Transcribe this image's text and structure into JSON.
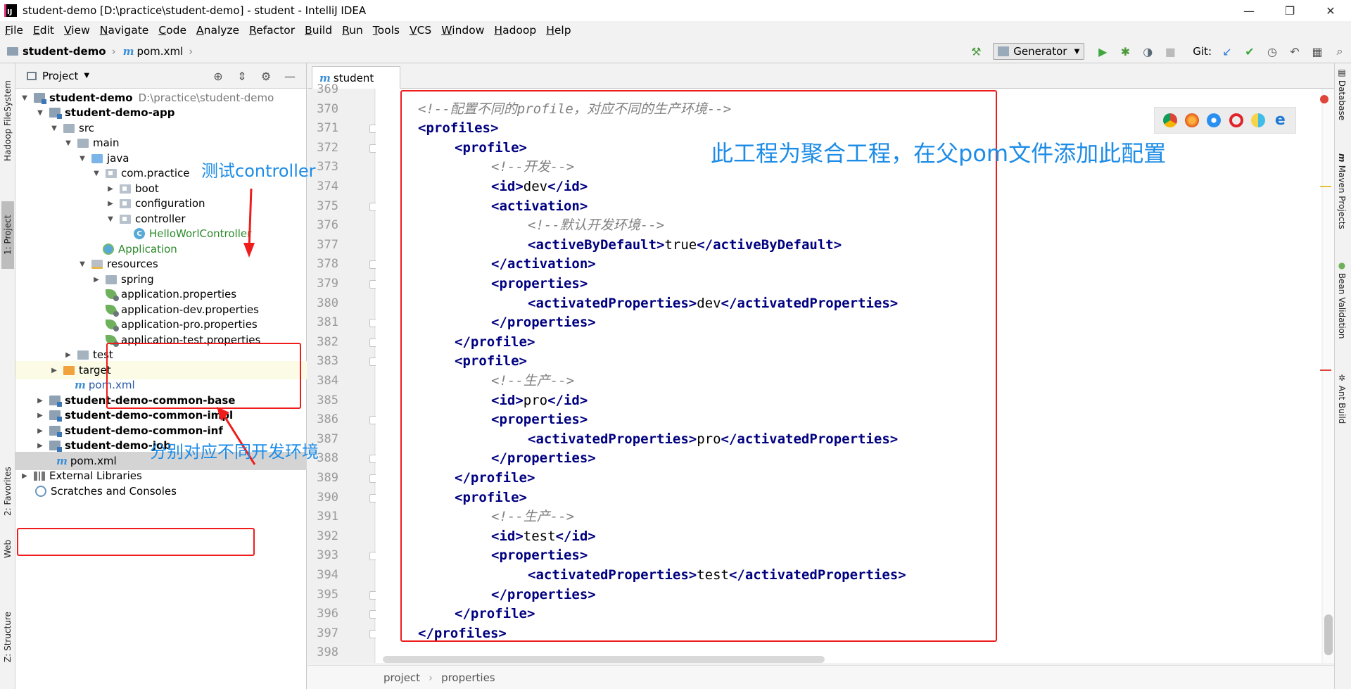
{
  "window": {
    "title": "student-demo [D:\\practice\\student-demo] - student - IntelliJ IDEA",
    "logo_text": "IJ",
    "minimize_glyph": "—",
    "maximize_glyph": "❐",
    "close_glyph": "✕"
  },
  "menu": [
    "File",
    "Edit",
    "View",
    "Navigate",
    "Code",
    "Analyze",
    "Refactor",
    "Build",
    "Run",
    "Tools",
    "VCS",
    "Window",
    "Hadoop",
    "Help"
  ],
  "breadcrumb": {
    "project": "student-demo",
    "file": "pom.xml",
    "file_icon": "m"
  },
  "toolbar": {
    "run_config": "Generator",
    "git_label": "Git:",
    "icons": [
      "hammer-icon",
      "run-icon",
      "debug-icon",
      "coverage-icon",
      "stop-icon",
      "vcs-update-icon",
      "vcs-commit-icon",
      "history-icon",
      "revert-icon",
      "project-structure-icon",
      "search-icon"
    ]
  },
  "left_tabs": {
    "hadoop": "Hadoop FileSystem",
    "project": "1: Project",
    "favorites": "2: Favorites",
    "web": "Web",
    "structure": "Z: Structure"
  },
  "right_tabs": {
    "database": "Database",
    "maven": "Maven Projects",
    "bean": "Bean Validation",
    "ant": "Ant Build"
  },
  "project_panel": {
    "title": "Project",
    "tree": [
      {
        "label": "student-demo",
        "hint": "D:\\practice\\student-demo"
      },
      {
        "label": "student-demo-app"
      },
      {
        "label": "src"
      },
      {
        "label": "main"
      },
      {
        "label": "java"
      },
      {
        "label": "com.practice"
      },
      {
        "label": "boot"
      },
      {
        "label": "configuration"
      },
      {
        "label": "controller"
      },
      {
        "label": "HelloWorlController"
      },
      {
        "label": "Application"
      },
      {
        "label": "resources"
      },
      {
        "label": "spring"
      },
      {
        "label": "application.properties"
      },
      {
        "label": "application-dev.properties"
      },
      {
        "label": "application-pro.properties"
      },
      {
        "label": "application-test.properties"
      },
      {
        "label": "test"
      },
      {
        "label": "target"
      },
      {
        "label": "pom.xml"
      },
      {
        "label": "student-demo-common-base"
      },
      {
        "label": "student-demo-common-impl"
      },
      {
        "label": "student-demo-common-inf"
      },
      {
        "label": "student-demo-job"
      },
      {
        "label": "pom.xml"
      },
      {
        "label": "External Libraries"
      },
      {
        "label": "Scratches and Consoles"
      }
    ]
  },
  "editor": {
    "tab": "student",
    "line_numbers": [
      "369",
      "370",
      "371",
      "372",
      "373",
      "374",
      "375",
      "376",
      "377",
      "378",
      "379",
      "380",
      "381",
      "382",
      "383",
      "384",
      "385",
      "386",
      "387",
      "388",
      "389",
      "390",
      "391",
      "392",
      "393",
      "394",
      "395",
      "396",
      "397",
      "398"
    ],
    "lines": [
      [],
      [
        [
          "cmt",
          "<!--配置不同的profile，对应不同的生产环境-->"
        ]
      ],
      [
        [
          "tag",
          "<profiles>"
        ]
      ],
      [
        [
          "tag",
          "<profile>"
        ]
      ],
      [
        [
          "cmt",
          "<!--开发-->"
        ]
      ],
      [
        [
          "tag",
          "<id>"
        ],
        [
          "txt",
          "dev"
        ],
        [
          "tag",
          "</id>"
        ]
      ],
      [
        [
          "tag",
          "<activation>"
        ]
      ],
      [
        [
          "cmt",
          "<!--默认开发环境-->"
        ]
      ],
      [
        [
          "tag",
          "<activeByDefault>"
        ],
        [
          "txt",
          "true"
        ],
        [
          "tag",
          "</activeByDefault>"
        ]
      ],
      [
        [
          "tag",
          "</activation>"
        ]
      ],
      [
        [
          "tag",
          "<properties>"
        ]
      ],
      [
        [
          "tag",
          "<activatedProperties>"
        ],
        [
          "txt",
          "dev"
        ],
        [
          "tag",
          "</activatedProperties>"
        ]
      ],
      [
        [
          "tag",
          "</properties>"
        ]
      ],
      [
        [
          "tag",
          "</profile>"
        ]
      ],
      [
        [
          "tag",
          "<profile>"
        ]
      ],
      [
        [
          "cmt",
          "<!--生产-->"
        ]
      ],
      [
        [
          "tag",
          "<id>"
        ],
        [
          "txt",
          "pro"
        ],
        [
          "tag",
          "</id>"
        ]
      ],
      [
        [
          "tag",
          "<properties>"
        ]
      ],
      [
        [
          "tag",
          "<activatedProperties>"
        ],
        [
          "txt",
          "pro"
        ],
        [
          "tag",
          "</activatedProperties>"
        ]
      ],
      [
        [
          "tag",
          "</properties>"
        ]
      ],
      [
        [
          "tag",
          "</profile>"
        ]
      ],
      [
        [
          "tag",
          "<profile>"
        ]
      ],
      [
        [
          "cmt",
          "<!--生产-->"
        ]
      ],
      [
        [
          "tag",
          "<id>"
        ],
        [
          "txt",
          "test"
        ],
        [
          "tag",
          "</id>"
        ]
      ],
      [
        [
          "tag",
          "<properties>"
        ]
      ],
      [
        [
          "tag",
          "<activatedProperties>"
        ],
        [
          "txt",
          "test"
        ],
        [
          "tag",
          "</activatedProperties>"
        ]
      ],
      [
        [
          "tag",
          "</properties>"
        ]
      ],
      [
        [
          "tag",
          "</profile>"
        ]
      ],
      [
        [
          "tag",
          "</profiles>"
        ]
      ],
      []
    ]
  },
  "annotations": {
    "controller_note": "测试controller",
    "env_note": "分别对应不同开发环境",
    "aggregate_note": "此工程为聚合工程，在父pom文件添加此配置"
  },
  "editor_breadcrumb": [
    "project",
    "properties"
  ],
  "colors": {
    "annotation_blue": "#1d8ce6",
    "highlight_red": "#ef1c1c",
    "tag_navy": "#000080",
    "comment_gray": "#808080"
  }
}
